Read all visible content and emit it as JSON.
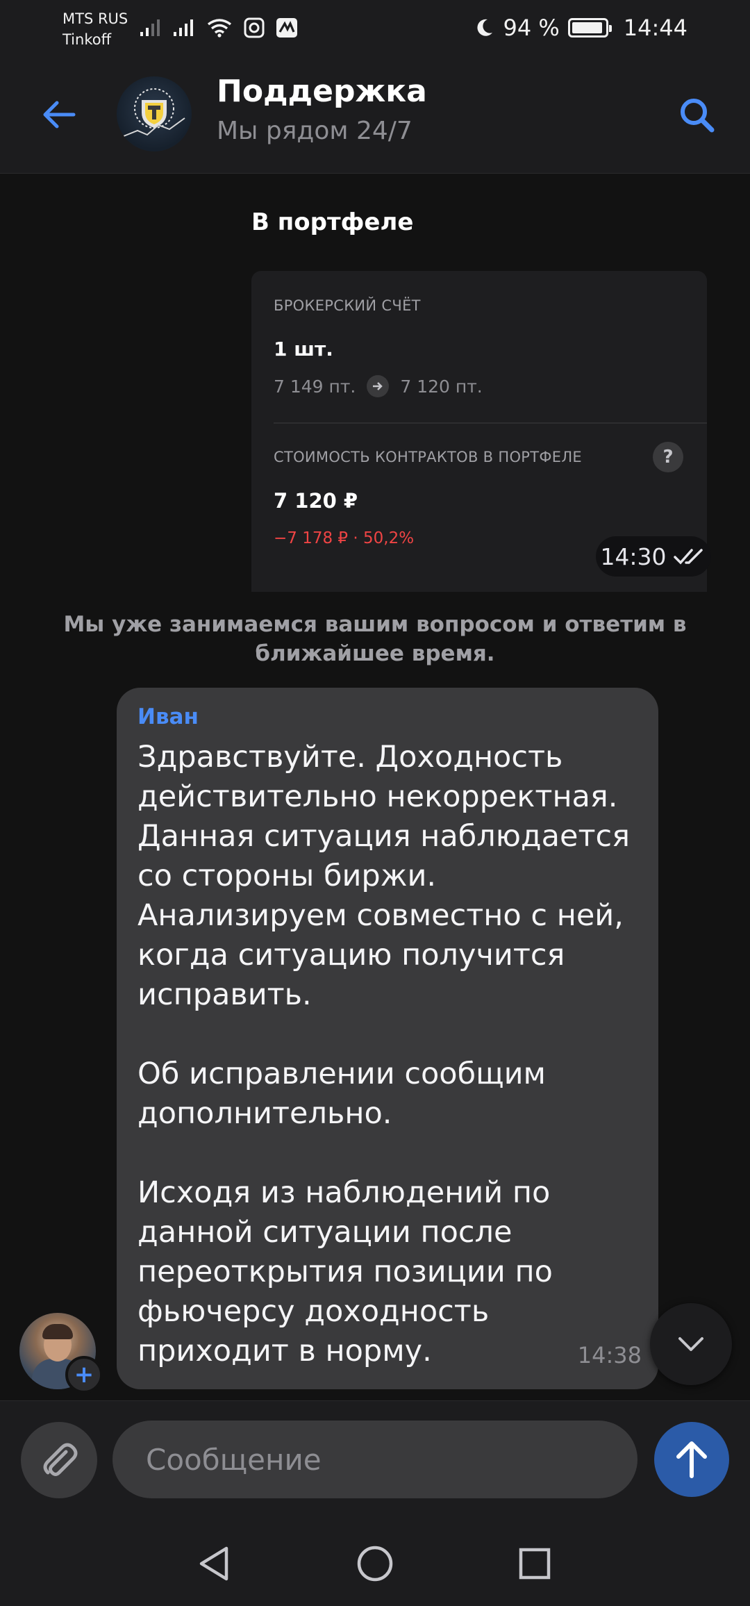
{
  "status_bar": {
    "carrier_line1": "MTS RUS",
    "carrier_line2": "Tinkoff",
    "battery_percent_label": "94 %",
    "battery_level": 0.94,
    "time": "14:44",
    "icons": [
      "signal-icon",
      "signal-icon",
      "wifi-icon",
      "nfc-icon",
      "messaging-app-icon",
      "moon-icon",
      "battery-icon"
    ]
  },
  "header": {
    "title": "Поддержка",
    "subtitle": "Мы рядом 24/7",
    "back_icon": "back-arrow-icon",
    "search_icon": "search-icon",
    "accent_color": "#4a8cf7"
  },
  "portfolio": {
    "title": "В портфеле",
    "account_label": "БРОКЕРСКИЙ СЧЁТ",
    "quantity": "1 шт.",
    "points_from": "7 149 пт.",
    "points_to": "7 120 пт.",
    "contracts_label": "СТОИМОСТЬ КОНТРАКТОВ В ПОРТФЕЛЕ",
    "help_symbol": "?",
    "cost": "7 120 ₽",
    "change": "−7 178 ₽ · 50,2%",
    "change_color": "#ef4444",
    "time": "14:30"
  },
  "system_message": "Мы уже занимаемся вашим вопросом и ответим в ближайшее время.",
  "message": {
    "sender": "Иван",
    "text": "Здравствуйте. Доходность действительно некорректная. Данная ситуация наблюдается со стороны биржи. Анализируем совместно с ней, когда ситуацию получится исправить.\n\nОб исправлении сообщим дополнительно.\n\nИсходя из наблюдений по данной ситуации после переоткрытия позиции по фьючерсу доходность приходит в норму.",
    "time": "14:38",
    "plus_symbol": "+"
  },
  "composer": {
    "placeholder": "Сообщение",
    "send_color": "#2b5ba8"
  }
}
